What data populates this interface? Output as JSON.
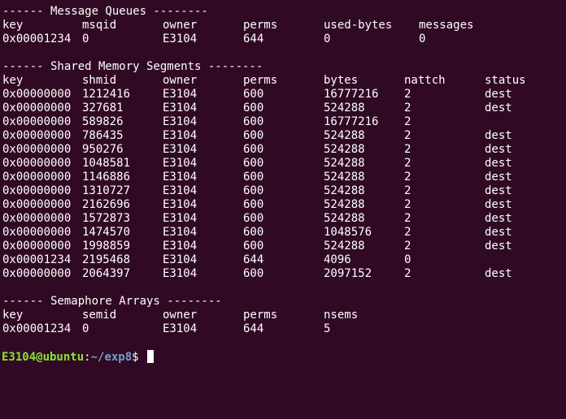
{
  "message_queues": {
    "title": "------ Message Queues --------",
    "headers": [
      "key",
      "msqid",
      "owner",
      "perms",
      "used-bytes",
      "messages"
    ],
    "rows": [
      [
        "0x00001234",
        "0",
        "E3104",
        "644",
        "0",
        "0"
      ]
    ]
  },
  "shared_memory": {
    "title": "------ Shared Memory Segments --------",
    "headers": [
      "key",
      "shmid",
      "owner",
      "perms",
      "bytes",
      "nattch",
      "status"
    ],
    "rows": [
      [
        "0x00000000",
        "1212416",
        "E3104",
        "600",
        "16777216",
        "2",
        "dest"
      ],
      [
        "0x00000000",
        "327681",
        "E3104",
        "600",
        "524288",
        "2",
        "dest"
      ],
      [
        "0x00000000",
        "589826",
        "E3104",
        "600",
        "16777216",
        "2",
        ""
      ],
      [
        "0x00000000",
        "786435",
        "E3104",
        "600",
        "524288",
        "2",
        "dest"
      ],
      [
        "0x00000000",
        "950276",
        "E3104",
        "600",
        "524288",
        "2",
        "dest"
      ],
      [
        "0x00000000",
        "1048581",
        "E3104",
        "600",
        "524288",
        "2",
        "dest"
      ],
      [
        "0x00000000",
        "1146886",
        "E3104",
        "600",
        "524288",
        "2",
        "dest"
      ],
      [
        "0x00000000",
        "1310727",
        "E3104",
        "600",
        "524288",
        "2",
        "dest"
      ],
      [
        "0x00000000",
        "2162696",
        "E3104",
        "600",
        "524288",
        "2",
        "dest"
      ],
      [
        "0x00000000",
        "1572873",
        "E3104",
        "600",
        "524288",
        "2",
        "dest"
      ],
      [
        "0x00000000",
        "1474570",
        "E3104",
        "600",
        "1048576",
        "2",
        "dest"
      ],
      [
        "0x00000000",
        "1998859",
        "E3104",
        "600",
        "524288",
        "2",
        "dest"
      ],
      [
        "0x00001234",
        "2195468",
        "E3104",
        "644",
        "4096",
        "0",
        ""
      ],
      [
        "0x00000000",
        "2064397",
        "E3104",
        "600",
        "2097152",
        "2",
        "dest"
      ]
    ]
  },
  "semaphore_arrays": {
    "title": "------ Semaphore Arrays --------",
    "headers": [
      "key",
      "semid",
      "owner",
      "perms",
      "nsems"
    ],
    "rows": [
      [
        "0x00001234",
        "0",
        "E3104",
        "644",
        "5"
      ]
    ]
  },
  "prompt": {
    "user_host": "E3104@ubuntu",
    "separator": ":",
    "path": "~/exp8",
    "symbol": "$ "
  },
  "colors": {
    "background": "#300a24",
    "text": "#ffffff",
    "prompt_user": "#8ae234",
    "prompt_path": "#729fcf"
  }
}
